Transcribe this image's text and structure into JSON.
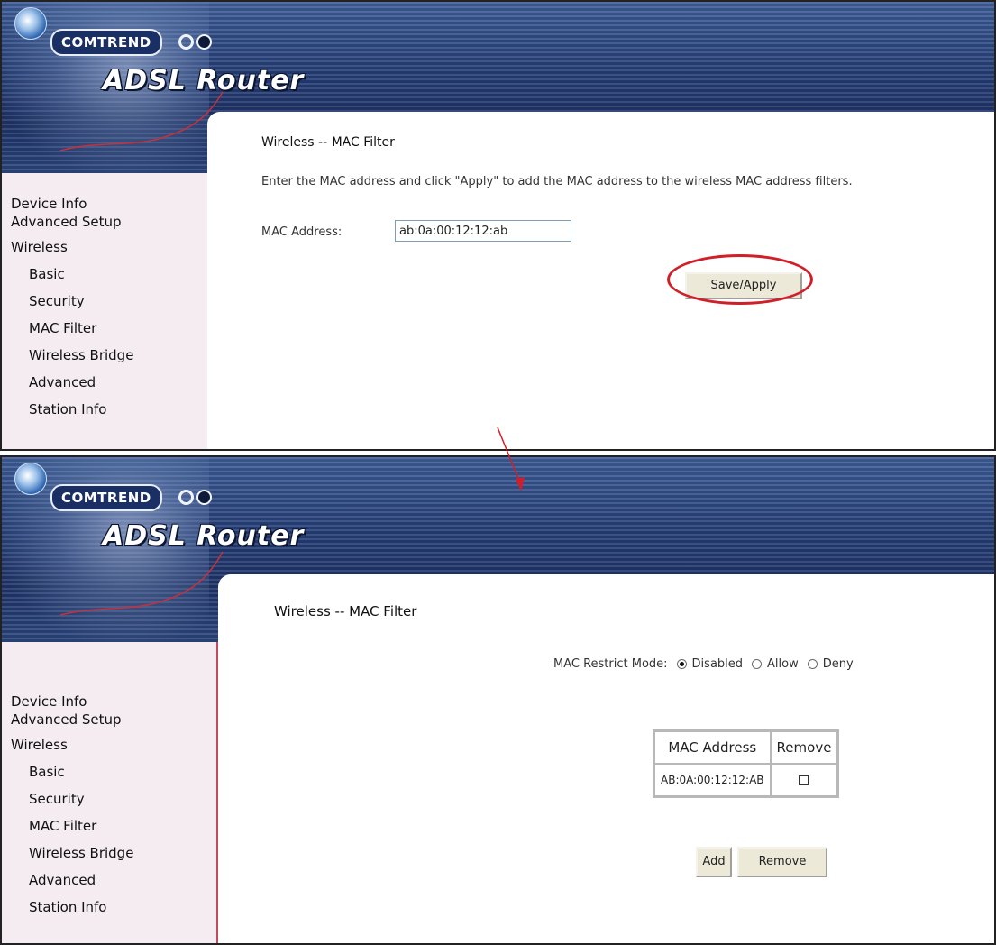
{
  "panel_before": {
    "brand": {
      "company": "COMTREND",
      "product": "ADSL Router"
    },
    "sidebar": {
      "items": [
        {
          "label": "Device Info"
        },
        {
          "label": "Advanced Setup"
        },
        {
          "label": "Wireless"
        },
        {
          "label": "Basic"
        },
        {
          "label": "Security"
        },
        {
          "label": "MAC Filter"
        },
        {
          "label": "Wireless Bridge"
        },
        {
          "label": "Advanced"
        },
        {
          "label": "Station Info"
        }
      ]
    },
    "content": {
      "title": "Wireless -- MAC Filter",
      "description": "Enter the MAC address and click \"Apply\" to add the MAC address to the wireless MAC address filters.",
      "mac_label": "MAC Address:",
      "mac_value": "ab:0a:00:12:12:ab",
      "save_button": "Save/Apply"
    }
  },
  "panel_after": {
    "brand": {
      "company": "COMTREND",
      "product": "ADSL Router"
    },
    "sidebar": {
      "items": [
        {
          "label": "Device Info"
        },
        {
          "label": "Advanced Setup"
        },
        {
          "label": "Wireless"
        },
        {
          "label": "Basic"
        },
        {
          "label": "Security"
        },
        {
          "label": "MAC Filter"
        },
        {
          "label": "Wireless Bridge"
        },
        {
          "label": "Advanced"
        },
        {
          "label": "Station Info"
        }
      ]
    },
    "content": {
      "title": "Wireless -- MAC Filter",
      "mode_label": "MAC Restrict Mode:",
      "modes": [
        {
          "label": "Disabled",
          "selected": true
        },
        {
          "label": "Allow",
          "selected": false
        },
        {
          "label": "Deny",
          "selected": false
        }
      ],
      "table": {
        "headers": [
          "MAC Address",
          "Remove"
        ],
        "rows": [
          {
            "mac": "AB:0A:00:12:12:AB",
            "remove_checked": false
          }
        ]
      },
      "add_button": "Add",
      "remove_button": "Remove"
    }
  },
  "colors": {
    "banner_blue": "#263f78",
    "sidebar_bg": "#f4ecf0",
    "highlight_red": "#d11f2a",
    "sidebar_border": "#c24a5c"
  }
}
